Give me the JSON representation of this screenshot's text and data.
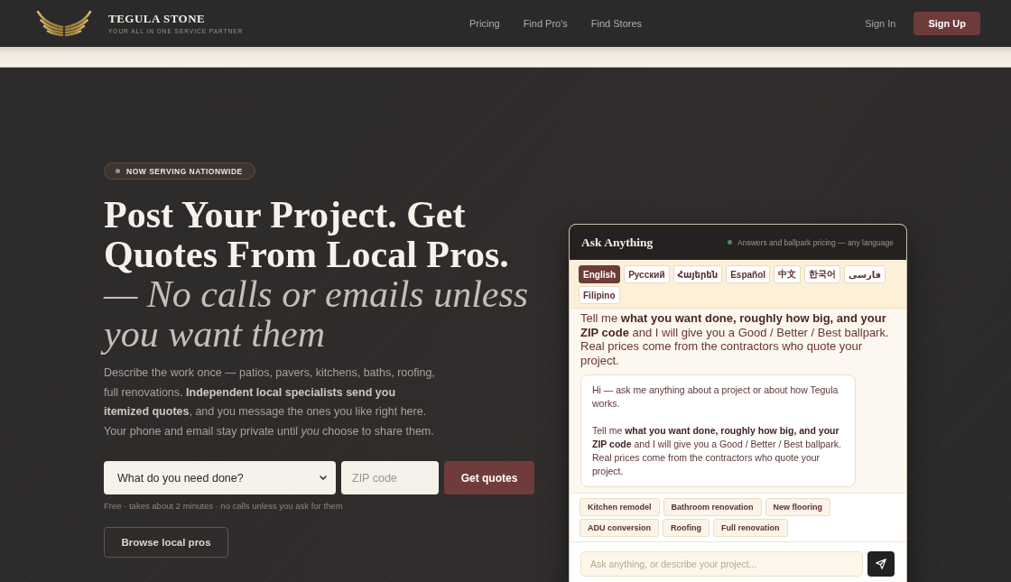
{
  "header": {
    "brand": {
      "name": "TEGULA STONE",
      "tagline": "YOUR ALL IN ONE SERVICE PARTNER"
    },
    "nav": [
      "Pricing",
      "Find Pro's",
      "Find Stores"
    ],
    "sign_in": "Sign In",
    "sign_up": "Sign Up"
  },
  "hero": {
    "badge": "NOW SERVING NATIONWIDE",
    "headline": "Post Your Project. Get Quotes From Local Pros.",
    "headline_italic": "— No calls or emails unless you want them",
    "description": "Describe the work once — patios, pavers, kitchens, baths, roofing, full renovations. **Independent local specialists send you itemized quotes**, and you message the ones you like right here. Your phone and email stay private until *you* choose to share them.",
    "form": {
      "service_select": "What do you need done?",
      "zip": {
        "placeholder": "ZIP code"
      },
      "submit": "Get quotes"
    },
    "note": "Free · takes about 2 minutes · no calls unless you ask for them",
    "browse": "Browse local pros"
  },
  "chat": {
    "title": "Ask Anything",
    "status": "Answers and ballpark pricing — any language",
    "languages": [
      {
        "label": "English",
        "selected": true
      },
      {
        "label": "Русский",
        "selected": false
      },
      {
        "label": "Հայերեն",
        "selected": false
      },
      {
        "label": "Español",
        "selected": false
      },
      {
        "label": "中文",
        "selected": false
      },
      {
        "label": "한국어",
        "selected": false
      },
      {
        "label": "فارسی",
        "selected": false
      },
      {
        "label": "Filipino",
        "selected": false
      }
    ],
    "messages": [
      {
        "kind": "plain",
        "text": "Tell me **what you want done, roughly how big, and your ZIP code** and I will give you a Good / Better / Best ballpark. Real prices come from the contractors who quote your project."
      },
      {
        "kind": "bubble",
        "paragraphs": [
          "Hi — ask me anything about a project or about how Tegula works.",
          "Tell me **what you want done, roughly how big, and your ZIP code** and I will give you a Good / Better / Best ballpark. Real prices come from the contractors who quote your project."
        ]
      }
    ],
    "suggestions": [
      "Kitchen remodel",
      "Bathroom renovation",
      "New flooring",
      "ADU conversion",
      "Roofing",
      "Full renovation"
    ],
    "input": {
      "placeholder": "Ask anything, or describe your project..."
    }
  }
}
